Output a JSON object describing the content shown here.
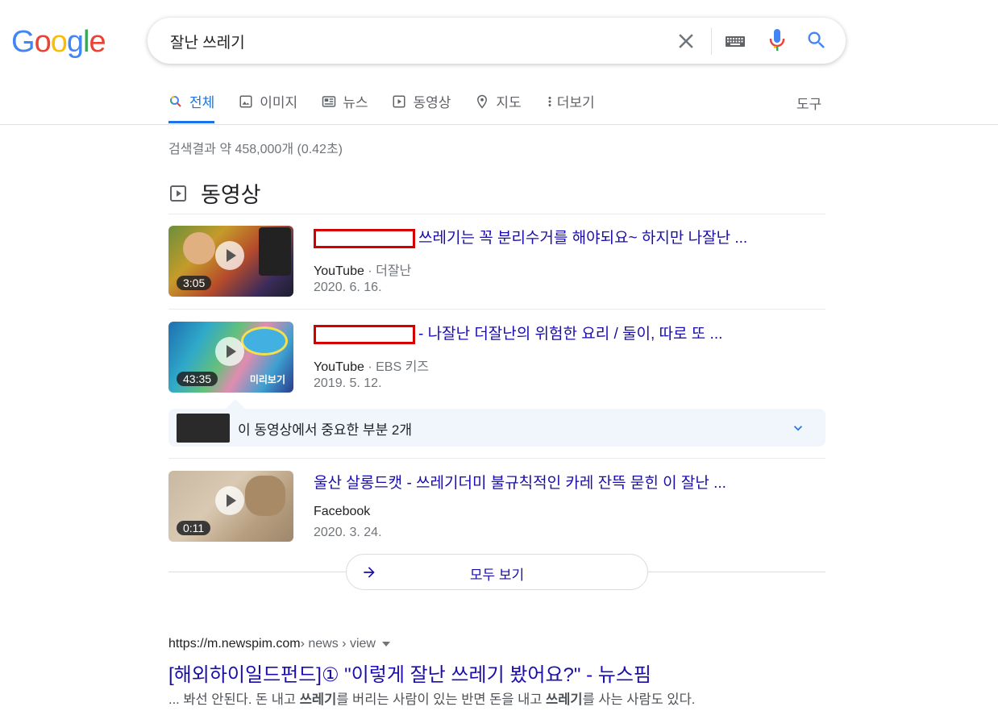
{
  "logo": {
    "text": "Google"
  },
  "search": {
    "query": "잘난 쓰레기"
  },
  "tabs": [
    {
      "label": "전체",
      "icon": "search-icon"
    },
    {
      "label": "이미지",
      "icon": "image-icon"
    },
    {
      "label": "뉴스",
      "icon": "news-icon"
    },
    {
      "label": "동영상",
      "icon": "video-icon"
    },
    {
      "label": "지도",
      "icon": "map-pin-icon"
    },
    {
      "label": "더보기",
      "icon": "more-vert-icon"
    }
  ],
  "tools_label": "도구",
  "stats": "검색결과 약 458,000개 (0.42초)",
  "videos": {
    "heading": "동영상",
    "items": [
      {
        "title": "쓰레기는 꼭 분리수거를 해야되요~ 하지만 나잘난 ...",
        "source": "YouTube",
        "channel": "· 더잘난",
        "date": "2020. 6. 16.",
        "duration": "3:05",
        "redacted": true
      },
      {
        "title": "- 나잘난 더잘난의 위험한 요리 / 둘이, 따로 또 ...",
        "source": "YouTube",
        "channel": "· EBS 키즈",
        "date": "2019. 5. 12.",
        "duration": "43:35",
        "preview": "미리보기",
        "redacted": true
      },
      {
        "title": "울산 살롱드캣 - 쓰레기더미 불규칙적인 카레 잔뜩 묻힌 이 잘난 ...",
        "source": "Facebook",
        "channel": "",
        "date": "2020. 3. 24.",
        "duration": "0:11",
        "redacted": false
      }
    ],
    "key_moments": "이 동영상에서 중요한 부분 2개",
    "see_all": "모두 보기"
  },
  "result": {
    "domain": "https://m.newspim.com",
    "path": " › news › view",
    "title": "[해외하이일드펀드]① \"이렇게 잘난 쓰레기 봤어요?\" - 뉴스핌",
    "snippet_parts": [
      {
        "text": "... 봐선 안된다. 돈 내고 ",
        "bold": false
      },
      {
        "text": "쓰레기",
        "bold": true
      },
      {
        "text": "를 버리는 사람이 있는 반면 돈을 내고 ",
        "bold": false
      },
      {
        "text": "쓰레기",
        "bold": true
      },
      {
        "text": "를 사는 사람도 있다.",
        "bold": false
      }
    ]
  },
  "colors": {
    "link": "#1a0dab",
    "accent": "#1a73e8",
    "redact": "#d40000"
  }
}
